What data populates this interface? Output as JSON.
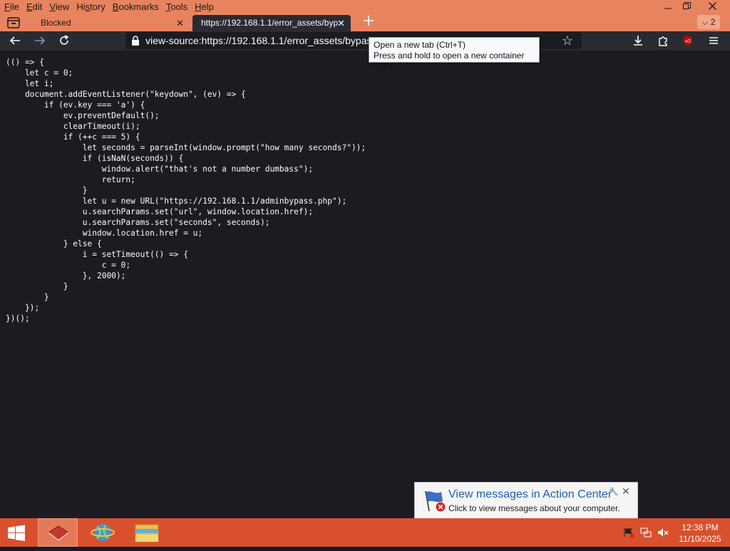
{
  "menu": [
    {
      "pre": "",
      "u": "F",
      "post": "ile"
    },
    {
      "pre": "",
      "u": "E",
      "post": "dit"
    },
    {
      "pre": "",
      "u": "V",
      "post": "iew"
    },
    {
      "pre": "Hi",
      "u": "s",
      "post": "tory"
    },
    {
      "pre": "",
      "u": "B",
      "post": "ookmarks"
    },
    {
      "pre": "",
      "u": "T",
      "post": "ools"
    },
    {
      "pre": "",
      "u": "H",
      "post": "elp"
    }
  ],
  "tabs": {
    "inactive": {
      "title": "Blocked"
    },
    "active": {
      "title": "https://192.168.1.1/error_assets/byp"
    },
    "list_all_count": "2"
  },
  "urlbar": {
    "url": "view-source:https://192.168.1.1/error_assets/bypass"
  },
  "tooltip": {
    "line1": "Open a new tab (Ctrl+T)",
    "line2": "Press and hold to open a new container tab"
  },
  "source_code": [
    "(() => {",
    "    let c = 0;",
    "    let i;",
    "    document.addEventListener(\"keydown\", (ev) => {",
    "        if (ev.key === 'a') {",
    "            ev.preventDefault();",
    "            clearTimeout(i);",
    "            if (++c === 5) {",
    "                let seconds = parseInt(window.prompt(\"how many seconds?\"));",
    "                if (isNaN(seconds)) {",
    "                    window.alert(\"that's not a number dumbass\");",
    "                    return;",
    "                }",
    "                let u = new URL(\"https://192.168.1.1/adminbypass.php\");",
    "                u.searchParams.set(\"url\", window.location.href);",
    "                u.searchParams.set(\"seconds\", seconds);",
    "                window.location.href = u;",
    "            } else {",
    "                i = setTimeout(() => {",
    "                    c = 0;",
    "                }, 2000);",
    "            }",
    "        }",
    "    });",
    "})();"
  ],
  "notification": {
    "title": "View messages in Action Center",
    "text": "Click to view messages about your computer."
  },
  "clock": {
    "time": "12:38 PM",
    "date": "11/10/2025"
  },
  "colors": {
    "accent": "#e8835f",
    "taskbar": "#d9502d",
    "page_bg": "#1c1b22"
  }
}
